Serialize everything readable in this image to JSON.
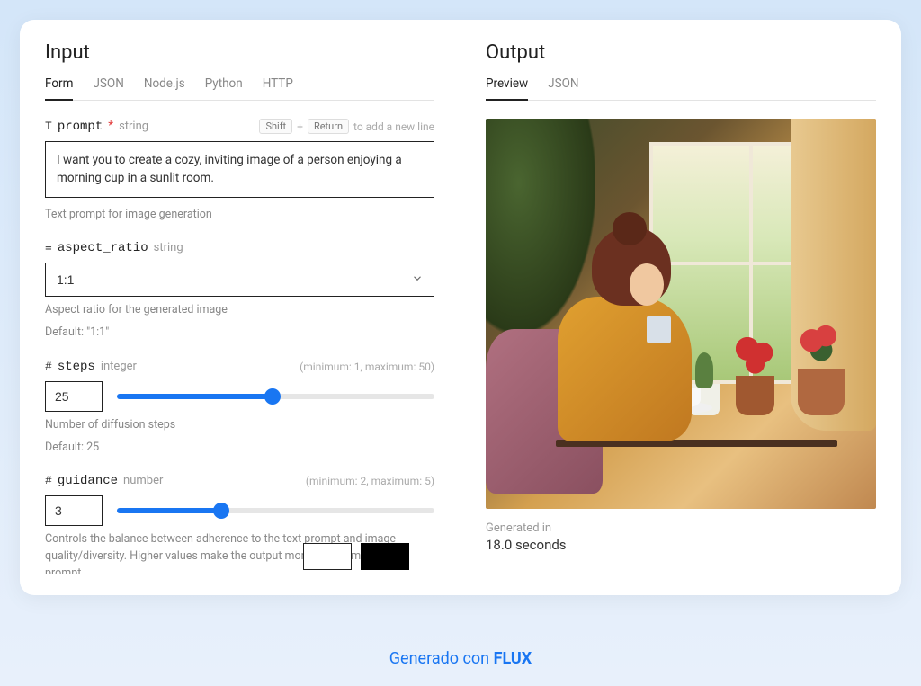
{
  "input": {
    "title": "Input",
    "tabs": [
      "Form",
      "JSON",
      "Node.js",
      "Python",
      "HTTP"
    ],
    "active_tab": "Form",
    "prompt": {
      "icon": "T",
      "name": "prompt",
      "required": "*",
      "type": "string",
      "hint_keys": {
        "k1": "Shift",
        "plus": "+",
        "k2": "Return",
        "tail": "to add a new line"
      },
      "value": "I want you to create a cozy, inviting image of a person enjoying a morning cup in a sunlit room.",
      "help": "Text prompt for image generation"
    },
    "aspect_ratio": {
      "icon": "≡",
      "name": "aspect_ratio",
      "type": "string",
      "value": "1:1",
      "help": "Aspect ratio for the generated image",
      "default": "Default: \"1:1\""
    },
    "steps": {
      "icon": "#",
      "name": "steps",
      "type": "integer",
      "range": "(minimum: 1, maximum: 50)",
      "value": "25",
      "min": 1,
      "max": 50,
      "help": "Number of diffusion steps",
      "default": "Default: 25"
    },
    "guidance": {
      "icon": "#",
      "name": "guidance",
      "type": "number",
      "range": "(minimum: 2, maximum: 5)",
      "value": "3",
      "min": 2,
      "max": 5,
      "help": "Controls the balance between adherence to the text prompt and image quality/diversity. Higher values make the output more closely match the prompt"
    }
  },
  "output": {
    "title": "Output",
    "tabs": [
      "Preview",
      "JSON"
    ],
    "active_tab": "Preview",
    "generated_label": "Generated in",
    "generated_time": "18.0 seconds"
  },
  "footer": {
    "pre": "Generado con ",
    "brand": "FLUX"
  }
}
